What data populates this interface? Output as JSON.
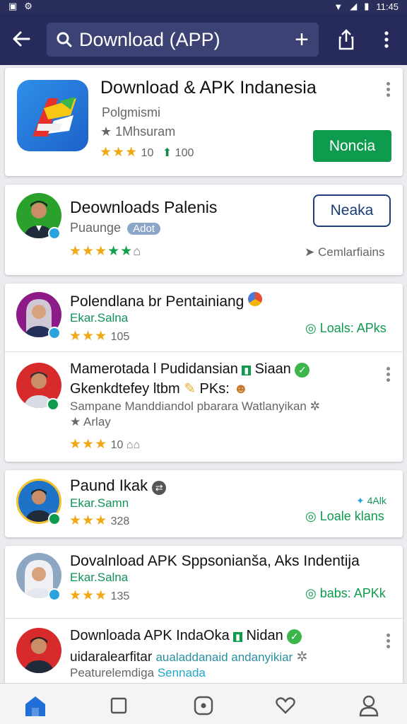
{
  "status": {
    "time": "11:45"
  },
  "appbar": {
    "search_text": "Download (APP)"
  },
  "card1": {
    "title": "Download & APK Indanesia",
    "developer": "Polgmismi",
    "category": "1Mhsuram",
    "rating": "10",
    "installs": "100",
    "button": "Noncia"
  },
  "card2": {
    "title": "Deownloads Palenis",
    "subtitle": "Puaunge",
    "tag": "Adot",
    "button": "Neaka",
    "meta": "Cemlarfiains"
  },
  "card3": {
    "row1": {
      "title": "Polendlana br Pentainiang",
      "author": "Ekar.Salna",
      "rating": "105",
      "action": "Loals: APks"
    },
    "row2": {
      "title_line1": "Mamerotada l Pudidansian",
      "title_tag": "Siaan",
      "title_line2": "Gkenkdtefey ltbm",
      "title_line2_tag": "PKs:",
      "desc": "Sampane Manddiandol pbarara Watlanyikan",
      "desc2": "Arlay",
      "rating": "10"
    }
  },
  "card4": {
    "title": "Paund Ikak",
    "author": "Ekar.Samn",
    "rating": "328",
    "badge": "4Alk",
    "action": "Loale klans"
  },
  "card5": {
    "row1": {
      "title": "Dovalnload APK Sppsonianša, Aks Indentija",
      "author": "Ekar.Salna",
      "rating": "135",
      "action": "babs: APKk"
    },
    "row2": {
      "title_line1": "Downloada APK IndaOka",
      "title_tag": "Nidan",
      "title_line2": "uidaralearfitar",
      "title_line2_tail": "aualaddanaid andanyikiar",
      "desc": "Peaturelemdiga",
      "desc_link": "Sennada"
    }
  },
  "nav": {
    "items": [
      "home-icon",
      "square-icon",
      "disc-icon",
      "heart-icon",
      "profile-icon"
    ]
  },
  "colors": {
    "appbar": "#262b5c",
    "accent_green": "#0f9b4e",
    "nav_active": "#1f6fd6",
    "link_teal": "#12935a"
  }
}
